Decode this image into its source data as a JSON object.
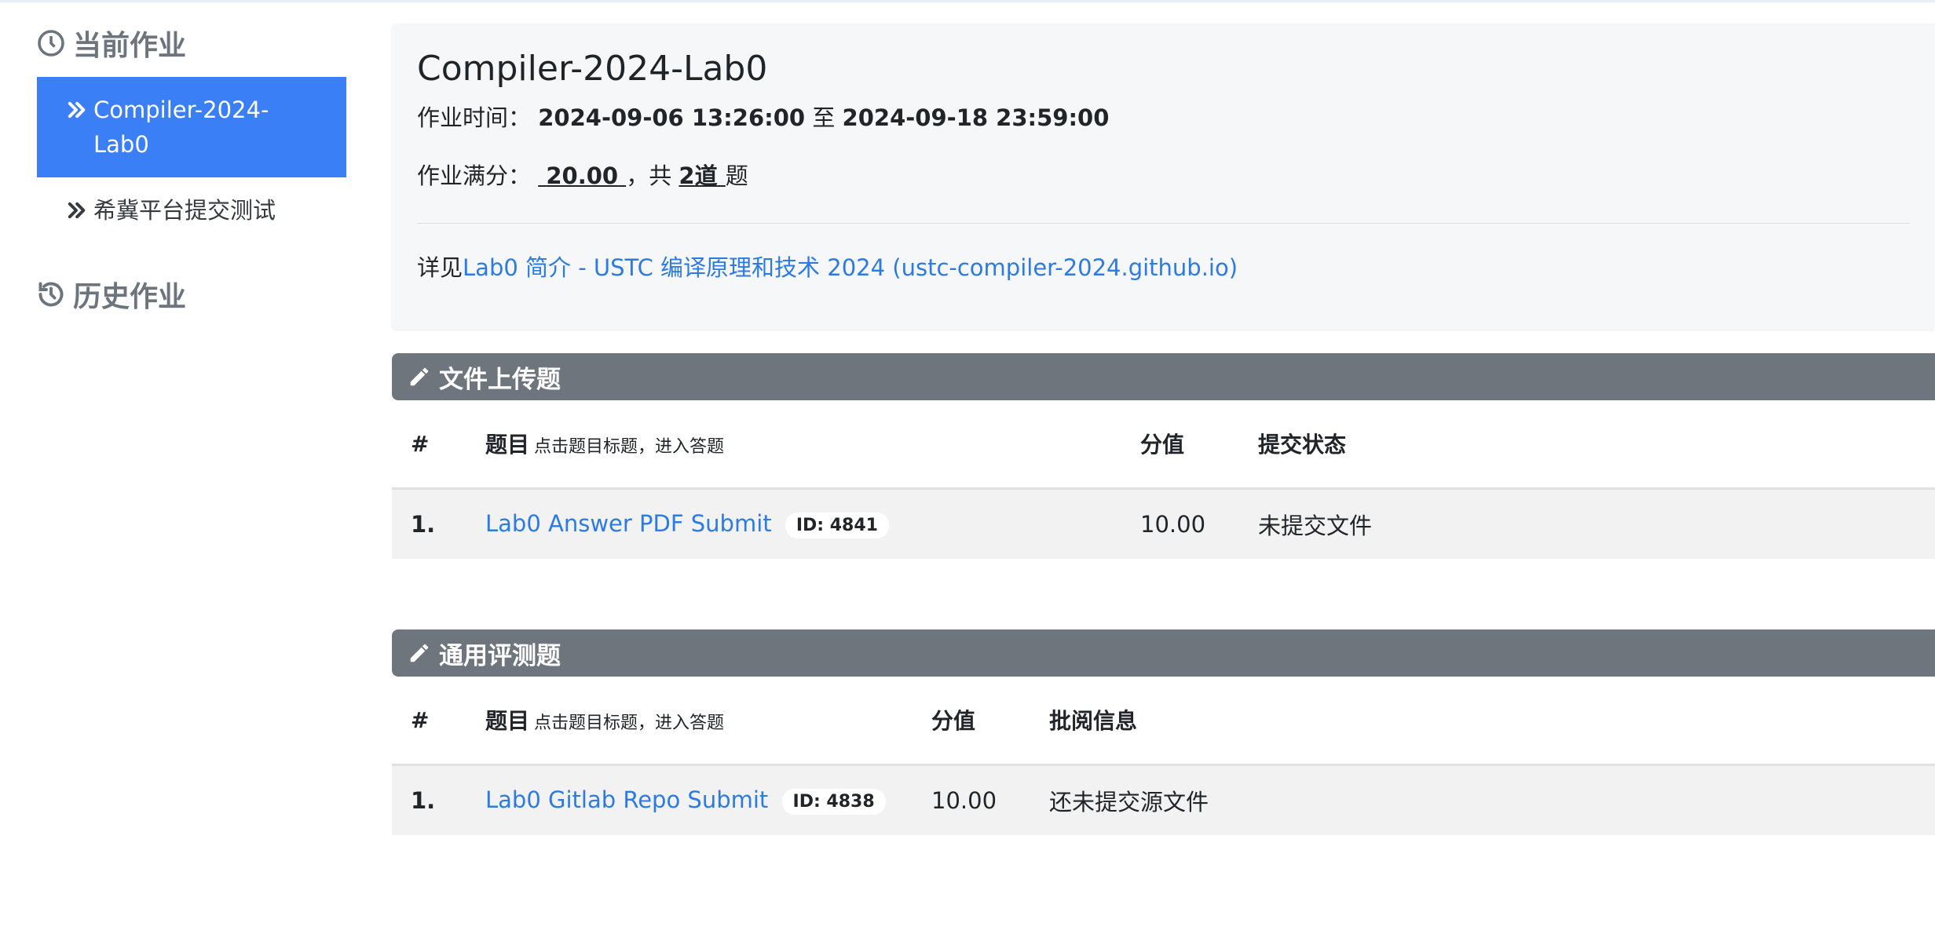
{
  "sidebar": {
    "current_heading": "当前作业",
    "items": [
      {
        "label": "Compiler-2024-Lab0",
        "active": true
      },
      {
        "label": "希冀平台提交测试",
        "active": false
      }
    ],
    "history_heading": "历史作业"
  },
  "assignment": {
    "title": "Compiler-2024-Lab0",
    "time_label": "作业时间：",
    "start": "2024-09-06 13:26:00",
    "to_word": "至",
    "end": "2024-09-18 23:59:00",
    "score_label": "作业满分：",
    "score": "20.00",
    "count_prefix": "，共",
    "count": "2道",
    "count_suffix": "题",
    "detail_prefix": "详见",
    "detail_link": "Lab0 简介 - USTC 编译原理和技术 2024 (ustc-compiler-2024.github.io)"
  },
  "sections": [
    {
      "title": "文件上传题",
      "headers": {
        "num": "#",
        "title": "题目",
        "hint": "点击题目标题，进入答题",
        "score": "分值",
        "status": "提交状态"
      },
      "rows": [
        {
          "num": "1.",
          "title": "Lab0 Answer PDF Submit",
          "id": "ID: 4841",
          "score": "10.00",
          "status": "未提交文件"
        }
      ]
    },
    {
      "title": "通用评测题",
      "headers": {
        "num": "#",
        "title": "题目",
        "hint": "点击题目标题，进入答题",
        "score": "分值",
        "status": "批阅信息"
      },
      "rows": [
        {
          "num": "1.",
          "title": "Lab0 Gitlab Repo Submit",
          "id": "ID: 4838",
          "score": "10.00",
          "status": "还未提交源文件"
        }
      ]
    }
  ]
}
